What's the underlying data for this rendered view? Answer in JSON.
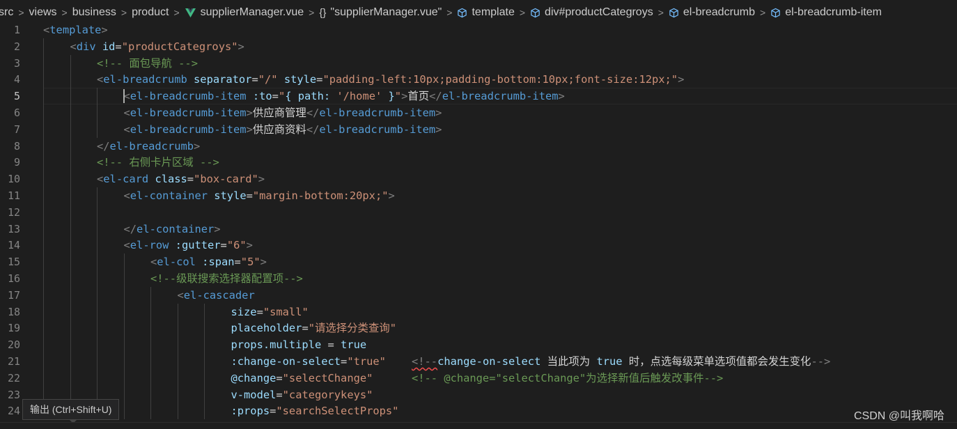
{
  "breadcrumb": {
    "items": [
      {
        "label": "src",
        "icon": ""
      },
      {
        "label": "views",
        "icon": ""
      },
      {
        "label": "business",
        "icon": ""
      },
      {
        "label": "product",
        "icon": ""
      },
      {
        "label": "supplierManager.vue",
        "icon": "vue-file-icon"
      },
      {
        "label": "\"supplierManager.vue\"",
        "icon": "braces-icon",
        "glyph": "{}"
      },
      {
        "label": "template",
        "icon": "cube-icon"
      },
      {
        "label": "div#productCategroys",
        "icon": "cube-icon"
      },
      {
        "label": "el-breadcrumb",
        "icon": "cube-icon"
      },
      {
        "label": "el-breadcrumb-item",
        "icon": "cube-icon"
      }
    ],
    "separator": ">"
  },
  "editor": {
    "active_line": 5,
    "line_numbers": [
      "1",
      "2",
      "3",
      "4",
      "5",
      "6",
      "7",
      "8",
      "9",
      "10",
      "11",
      "12",
      "13",
      "14",
      "15",
      "16",
      "17",
      "18",
      "19",
      "20",
      "21",
      "22",
      "23",
      "24"
    ],
    "lines": [
      [
        [
          "p",
          "<"
        ],
        [
          "t",
          "template"
        ],
        [
          "p",
          ">"
        ]
      ],
      [
        [
          "p",
          "<"
        ],
        [
          "t",
          "div"
        ],
        [
          "x",
          " "
        ],
        [
          "a",
          "id"
        ],
        [
          "x",
          "="
        ],
        [
          "v",
          "\"productCategroys\""
        ],
        [
          "p",
          ">"
        ]
      ],
      [
        [
          "c",
          "<!-- 面包导航 -->"
        ]
      ],
      [
        [
          "p",
          "<"
        ],
        [
          "t",
          "el-breadcrumb"
        ],
        [
          "x",
          " "
        ],
        [
          "a",
          "separator"
        ],
        [
          "x",
          "="
        ],
        [
          "v",
          "\"/\""
        ],
        [
          "x",
          " "
        ],
        [
          "a",
          "style"
        ],
        [
          "x",
          "="
        ],
        [
          "v",
          "\"padding-left:10px;padding-bottom:10px;font-size:12px;\""
        ],
        [
          "p",
          ">"
        ]
      ],
      [
        [
          "p",
          "<"
        ],
        [
          "t",
          "el-breadcrumb-item"
        ],
        [
          "x",
          " "
        ],
        [
          "a",
          ":to"
        ],
        [
          "x",
          "="
        ],
        [
          "v",
          "\""
        ],
        [
          "a",
          "{ path: "
        ],
        [
          "v",
          "'/home'"
        ],
        [
          "a",
          " }"
        ],
        [
          "v",
          "\""
        ],
        [
          "p",
          ">"
        ],
        [
          "x",
          "首页"
        ],
        [
          "p",
          "</"
        ],
        [
          "t",
          "el-breadcrumb-item"
        ],
        [
          "p",
          ">"
        ]
      ],
      [
        [
          "p",
          "<"
        ],
        [
          "t",
          "el-breadcrumb-item"
        ],
        [
          "p",
          ">"
        ],
        [
          "x",
          "供应商管理"
        ],
        [
          "p",
          "</"
        ],
        [
          "t",
          "el-breadcrumb-item"
        ],
        [
          "p",
          ">"
        ]
      ],
      [
        [
          "p",
          "<"
        ],
        [
          "t",
          "el-breadcrumb-item"
        ],
        [
          "p",
          ">"
        ],
        [
          "x",
          "供应商资料"
        ],
        [
          "p",
          "</"
        ],
        [
          "t",
          "el-breadcrumb-item"
        ],
        [
          "p",
          ">"
        ]
      ],
      [
        [
          "p",
          "</"
        ],
        [
          "t",
          "el-breadcrumb"
        ],
        [
          "p",
          ">"
        ]
      ],
      [
        [
          "c",
          "<!-- 右侧卡片区域 -->"
        ]
      ],
      [
        [
          "p",
          "<"
        ],
        [
          "t",
          "el-card"
        ],
        [
          "x",
          " "
        ],
        [
          "a",
          "class"
        ],
        [
          "x",
          "="
        ],
        [
          "v",
          "\"box-card\""
        ],
        [
          "p",
          ">"
        ]
      ],
      [
        [
          "p",
          "<"
        ],
        [
          "t",
          "el-container"
        ],
        [
          "x",
          " "
        ],
        [
          "a",
          "style"
        ],
        [
          "x",
          "="
        ],
        [
          "v",
          "\"margin-bottom:20px;\""
        ],
        [
          "p",
          ">"
        ]
      ],
      [],
      [
        [
          "p",
          "</"
        ],
        [
          "t",
          "el-container"
        ],
        [
          "p",
          ">"
        ]
      ],
      [
        [
          "p",
          "<"
        ],
        [
          "t",
          "el-row"
        ],
        [
          "x",
          " "
        ],
        [
          "a",
          ":gutter"
        ],
        [
          "x",
          "="
        ],
        [
          "v",
          "\"6\""
        ],
        [
          "p",
          ">"
        ]
      ],
      [
        [
          "p",
          "<"
        ],
        [
          "t",
          "el-col"
        ],
        [
          "x",
          " "
        ],
        [
          "a",
          ":span"
        ],
        [
          "x",
          "="
        ],
        [
          "v",
          "\"5\""
        ],
        [
          "p",
          ">"
        ]
      ],
      [
        [
          "c",
          "<!--级联搜索选择器配置项-->"
        ]
      ],
      [
        [
          "p",
          "<"
        ],
        [
          "t",
          "el-cascader"
        ]
      ],
      [
        [
          "a",
          "size"
        ],
        [
          "x",
          "="
        ],
        [
          "v",
          "\"small\""
        ]
      ],
      [
        [
          "a",
          "placeholder"
        ],
        [
          "x",
          "="
        ],
        [
          "v",
          "\"请选择分类查询\""
        ]
      ],
      [
        [
          "a",
          "props.multiple"
        ],
        [
          "x",
          " = "
        ],
        [
          "a",
          "true"
        ]
      ],
      [
        [
          "a",
          ":change-on-select"
        ],
        [
          "x",
          "="
        ],
        [
          "v",
          "\"true\""
        ],
        [
          "x",
          "    "
        ],
        [
          "p",
          "<!--",
          "err"
        ],
        [
          "a",
          "change-on-select"
        ],
        [
          "x",
          " 当此项为 "
        ],
        [
          "a",
          "true"
        ],
        [
          "x",
          " 时，点选每级菜单选项值都会发生变化"
        ],
        [
          "p",
          "-->"
        ]
      ],
      [
        [
          "a",
          "@change"
        ],
        [
          "x",
          "="
        ],
        [
          "v",
          "\"selectChange\""
        ],
        [
          "x",
          "      "
        ],
        [
          "c",
          "<!-- @change=\"selectChange\"为选择新值后触发改事件-->"
        ]
      ],
      [
        [
          "a",
          "v-model"
        ],
        [
          "x",
          "="
        ],
        [
          "v",
          "\"categorykeys\""
        ]
      ],
      [
        [
          "a",
          ":props"
        ],
        [
          "x",
          "="
        ],
        [
          "v",
          "\"searchSelectProps\""
        ]
      ]
    ]
  },
  "tooltip": {
    "text": "输出 (Ctrl+Shift+U)"
  },
  "watermark": {
    "text": "CSDN @叫我啊哈"
  },
  "colors": {
    "background": "#1e1e1e",
    "tag": "#569cd6",
    "attribute": "#9cdcfe",
    "string": "#ce9178",
    "comment": "#6a9955",
    "punctuation": "#808080",
    "vue_icon": "#41b883",
    "symbol_icon": "#75beff"
  }
}
